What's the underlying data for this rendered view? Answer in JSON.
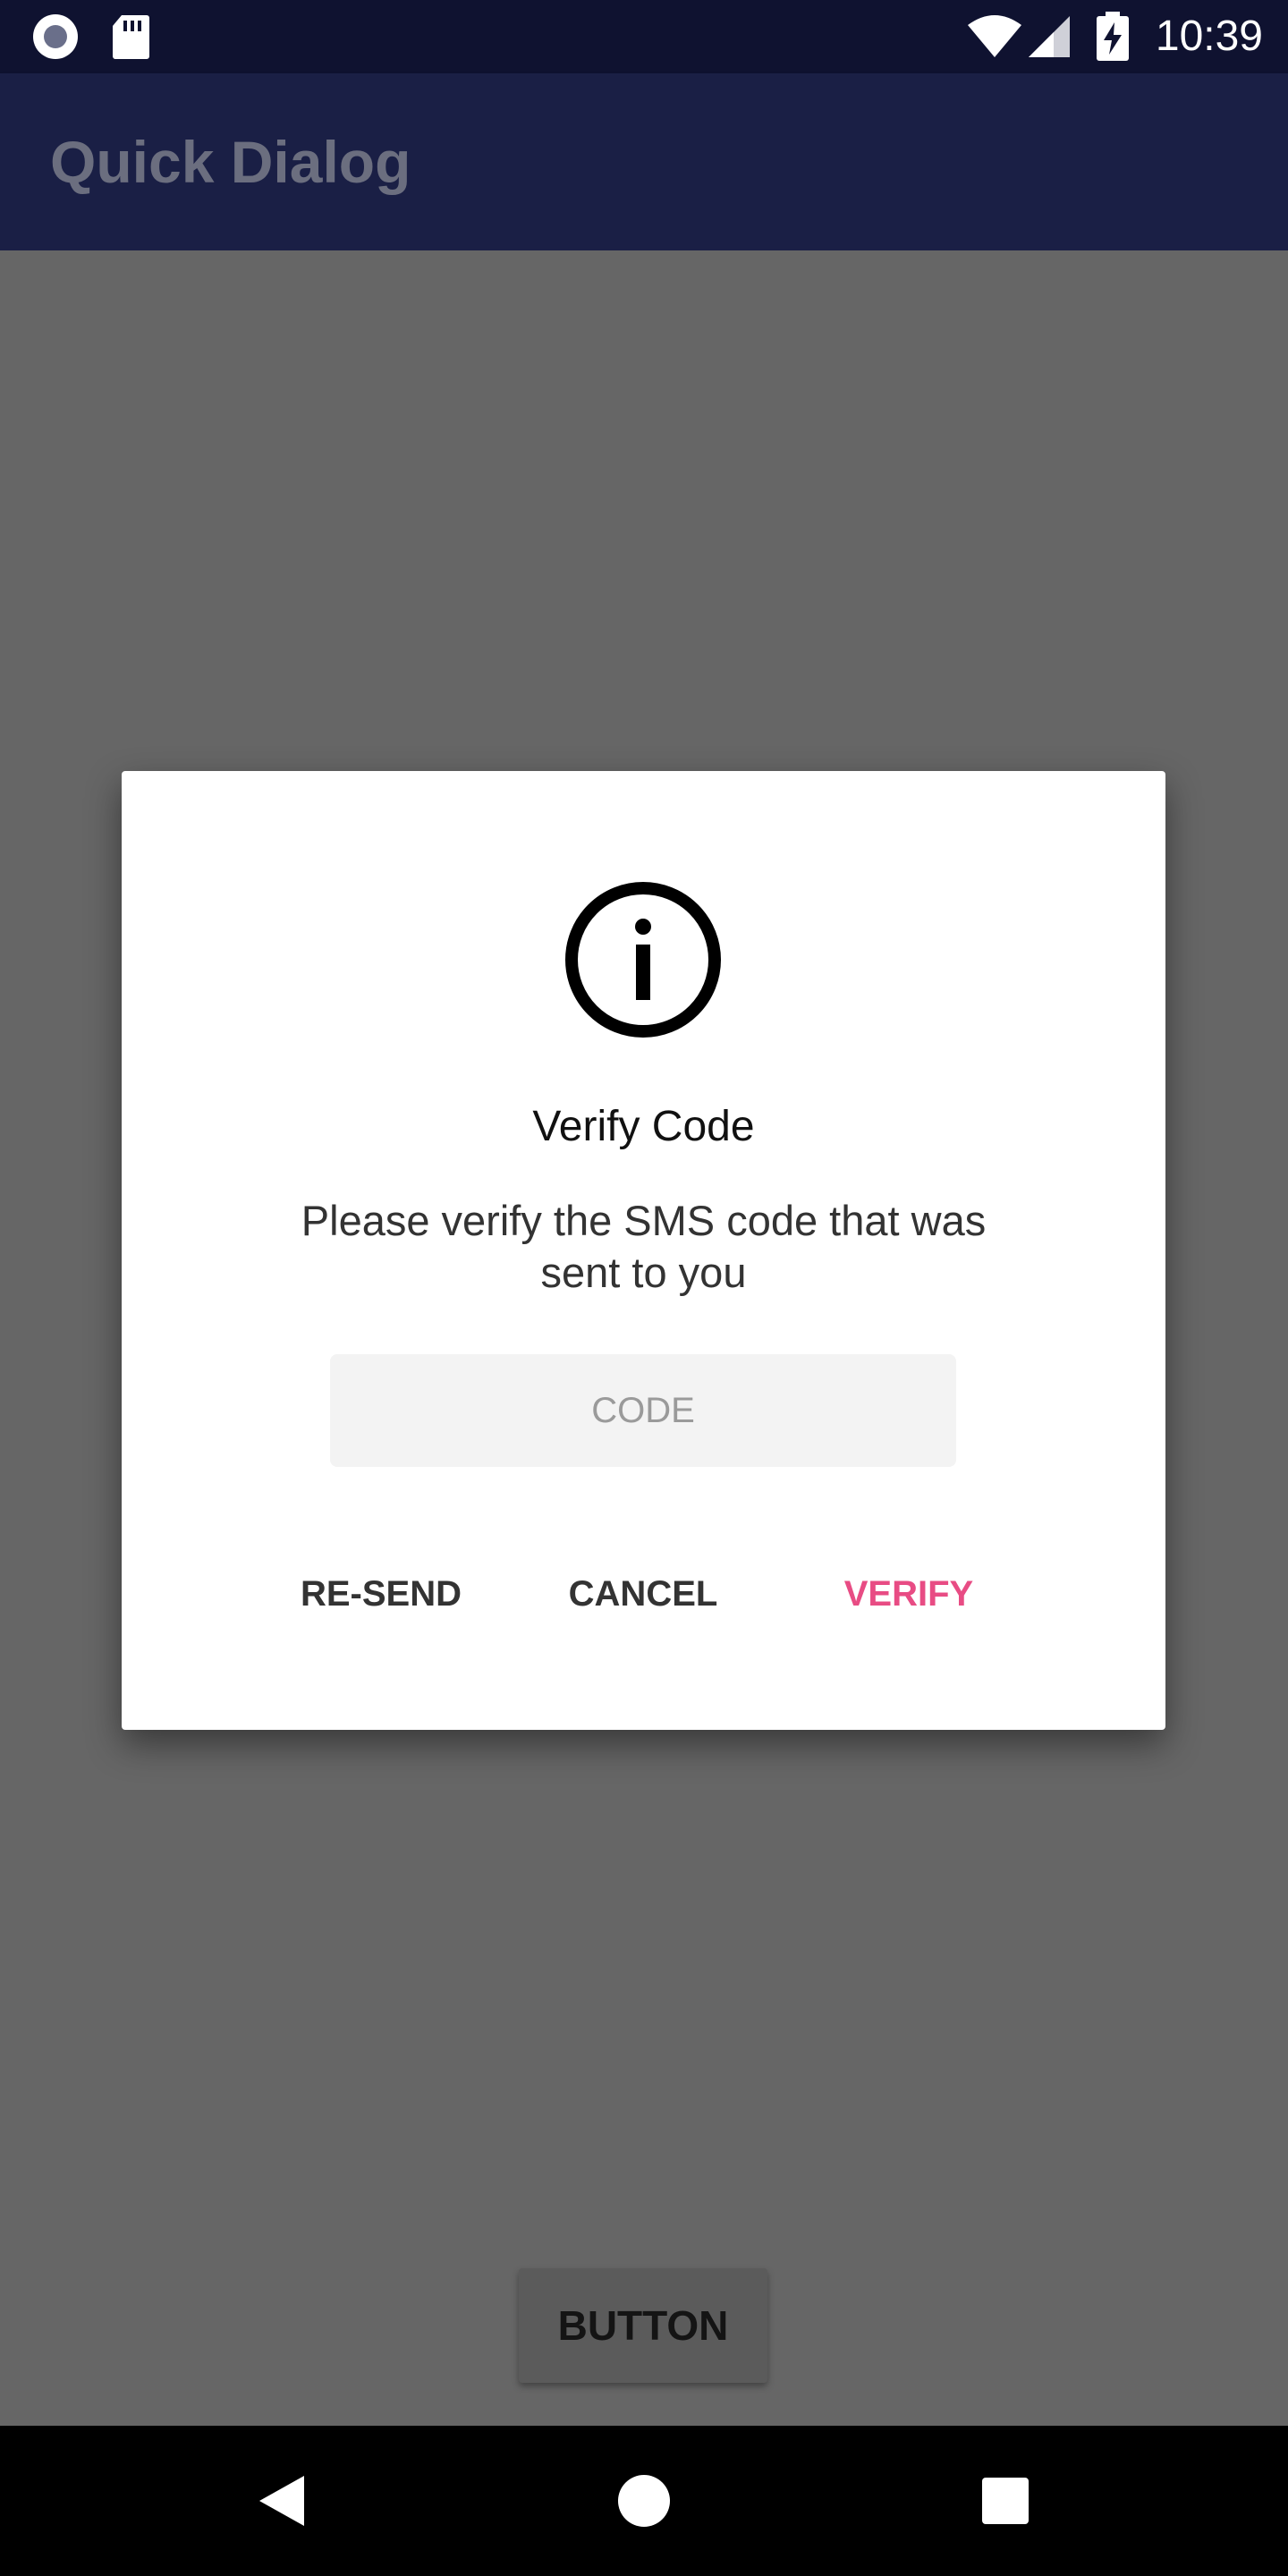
{
  "status_bar": {
    "time": "10:39",
    "icons": [
      "radio-notification-icon",
      "sd-card-icon",
      "wifi-icon",
      "signal-icon",
      "battery-charging-icon"
    ]
  },
  "app_bar": {
    "title": "Quick Dialog"
  },
  "main": {
    "button_label": "BUTTON"
  },
  "dialog": {
    "icon": "info-icon",
    "title": "Verify Code",
    "message": "Please verify the SMS code that was sent to you",
    "code_input": {
      "placeholder": "CODE",
      "value": ""
    },
    "buttons": {
      "resend": "RE-SEND",
      "cancel": "CANCEL",
      "verify": "VERIFY"
    }
  },
  "nav_bar": {
    "icons": [
      "back-icon",
      "home-icon",
      "recents-icon"
    ]
  },
  "colors": {
    "status_bar": "#0f1230",
    "app_bar": "#1a1f45",
    "scrim_background": "#666666",
    "accent": "#e84c84"
  }
}
